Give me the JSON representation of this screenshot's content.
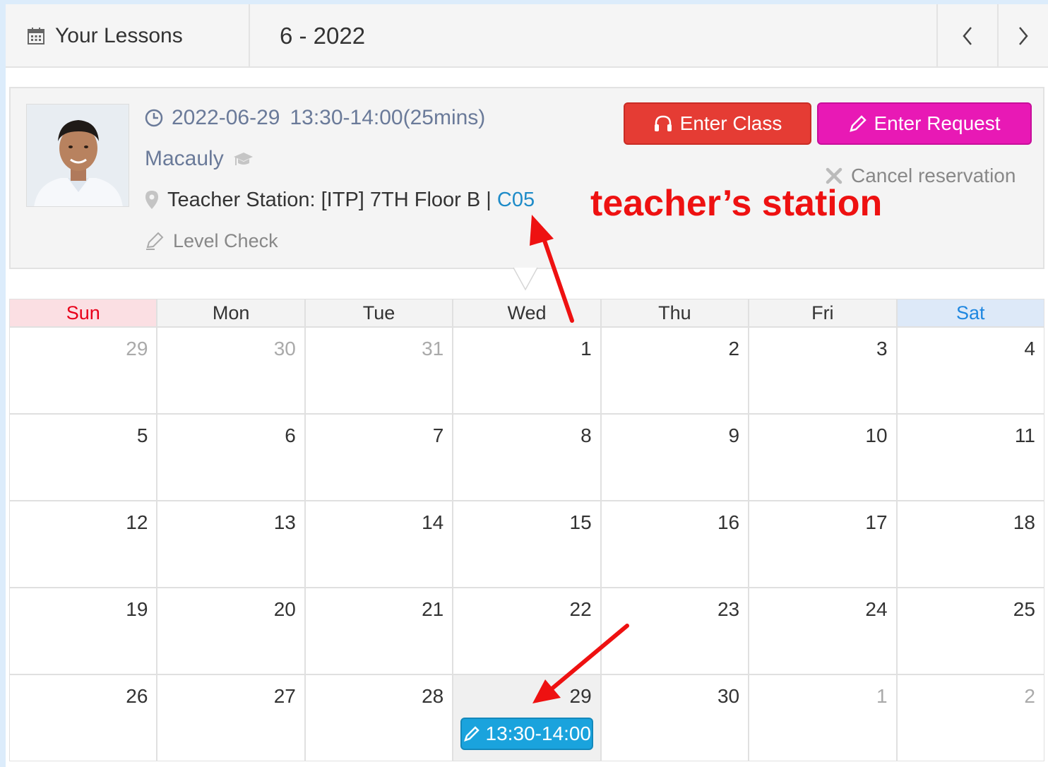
{
  "header": {
    "title": "Your Lessons",
    "month": "6 - 2022",
    "prev_icon": "chevron-left-icon",
    "next_icon": "chevron-right-icon"
  },
  "lesson": {
    "date": "2022-06-29",
    "time": "13:30-14:00(25mins)",
    "teacher": "Macauly",
    "station_label": "Teacher Station: [ITP] 7TH Floor B | ",
    "station_code": "C05",
    "level": "Level Check",
    "enter_class": "Enter Class",
    "enter_request": "Enter Request",
    "cancel": "Cancel reservation"
  },
  "annotation": "teacher’s station",
  "calendar": {
    "days": [
      "Sun",
      "Mon",
      "Tue",
      "Wed",
      "Thu",
      "Fri",
      "Sat"
    ],
    "weeks": [
      [
        "29",
        "30",
        "31",
        "1",
        "2",
        "3",
        "4"
      ],
      [
        "5",
        "6",
        "7",
        "8",
        "9",
        "10",
        "11"
      ],
      [
        "12",
        "13",
        "14",
        "15",
        "16",
        "17",
        "18"
      ],
      [
        "19",
        "20",
        "21",
        "22",
        "23",
        "24",
        "25"
      ],
      [
        "26",
        "27",
        "28",
        "29",
        "30",
        "1",
        "2"
      ]
    ],
    "event_time": "13:30-14:00"
  },
  "colors": {
    "enter_class": "#e53c34",
    "enter_request": "#e819b5",
    "event": "#1aa3dd",
    "sunday": "#e8001a",
    "saturday": "#1f87e0",
    "annotation": "#ee1111"
  }
}
